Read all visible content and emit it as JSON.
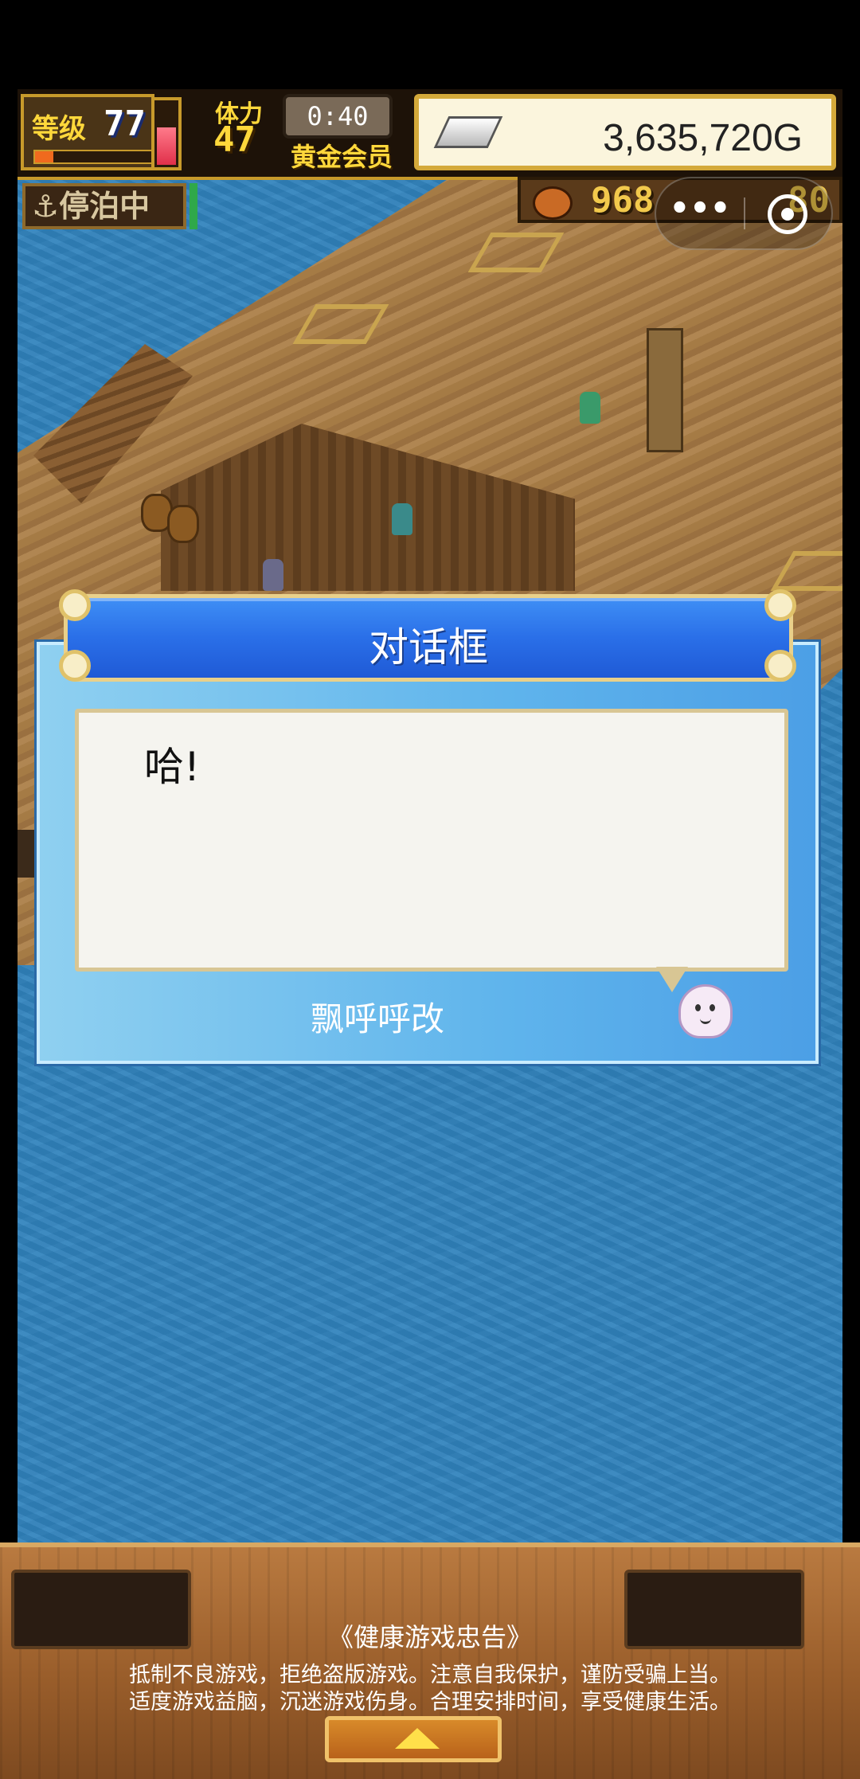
{
  "hud": {
    "level_label": "等级",
    "level": "77",
    "exp_fraction": 0.15,
    "stamina_label": "体力",
    "stamina": "47",
    "stamina_fraction": 0.6,
    "timer": "0:40",
    "membership": "黄金会员",
    "gold": "3,635,720G",
    "status": "停泊中",
    "resource_value": "968",
    "resource_extra": "80"
  },
  "capsule": {
    "more_label": "•••",
    "close_label": ""
  },
  "dialog": {
    "title": "对话框",
    "message": "哈!",
    "speaker": "飘呼呼改"
  },
  "advisory": {
    "title": "《健康游戏忠告》",
    "line1": "抵制不良游戏，拒绝盗版游戏。注意自我保护，谨防受骗上当。",
    "line2": "适度游戏益脑，沉迷游戏伤身。合理安排时间，享受健康生活。"
  },
  "colors": {
    "dialog_blue": "#2a6fe8",
    "gold_text": "#ffd83b",
    "wood": "#9a5e2b"
  }
}
